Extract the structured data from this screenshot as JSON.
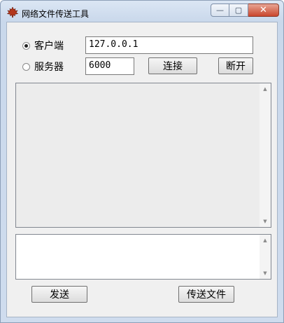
{
  "window": {
    "title": "网络文件传送工具",
    "minimize_glyph": "—",
    "maximize_glyph": "▢",
    "close_glyph": "✕"
  },
  "mode": {
    "client_label": "客户端",
    "server_label": "服务器",
    "selected": "client"
  },
  "connection": {
    "ip_value": "127.0.0.1",
    "port_value": "6000",
    "connect_label": "连接",
    "disconnect_label": "断开"
  },
  "scroll": {
    "up_glyph": "▲",
    "down_glyph": "▼"
  },
  "actions": {
    "send_label": "发送",
    "send_file_label": "传送文件"
  },
  "icons": {
    "app": "maple-leaf-icon"
  },
  "colors": {
    "client_area": "#f0f0f0",
    "log_background": "#ececec",
    "close_button": "#c9462d"
  }
}
